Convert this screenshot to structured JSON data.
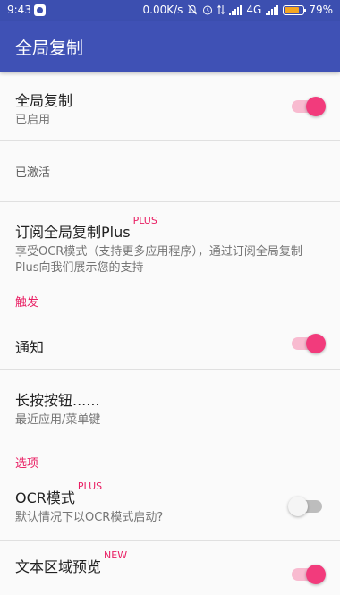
{
  "status_bar": {
    "time": "9:43",
    "network_speed": "0.00K/s",
    "network_type": "4G",
    "battery": "79%",
    "battery_level": 0.79,
    "icons": [
      "app-notification-icon",
      "mute-icon",
      "alarm-icon",
      "data-transfer-icon",
      "signal-icon",
      "battery-icon"
    ]
  },
  "app_bar": {
    "title": "全局复制"
  },
  "settings": {
    "global_copy": {
      "title": "全局复制",
      "summary": "已启用",
      "enabled": true
    },
    "activated": {
      "text": "已激活"
    },
    "subscribe": {
      "title": "订阅全局复制Plus",
      "badge": "PLUS",
      "summary": "享受OCR模式（支持更多应用程序），通过订阅全局复制Plus向我们展示您的支持"
    },
    "category_trigger": "触发",
    "notification": {
      "title": "通知",
      "enabled": true
    },
    "long_press": {
      "title": "长按按钮......",
      "summary": "最近应用/菜单键"
    },
    "category_options": "选项",
    "ocr_mode": {
      "title": "OCR模式",
      "badge": "PLUS",
      "summary": "默认情况下以OCR模式启动?",
      "enabled": false
    },
    "text_preview": {
      "title": "文本区域预览",
      "badge": "NEW",
      "enabled": true
    }
  },
  "colors": {
    "primary": "#3f51b5",
    "status_bar": "#3c4fb0",
    "accent": "#f23b7c"
  }
}
